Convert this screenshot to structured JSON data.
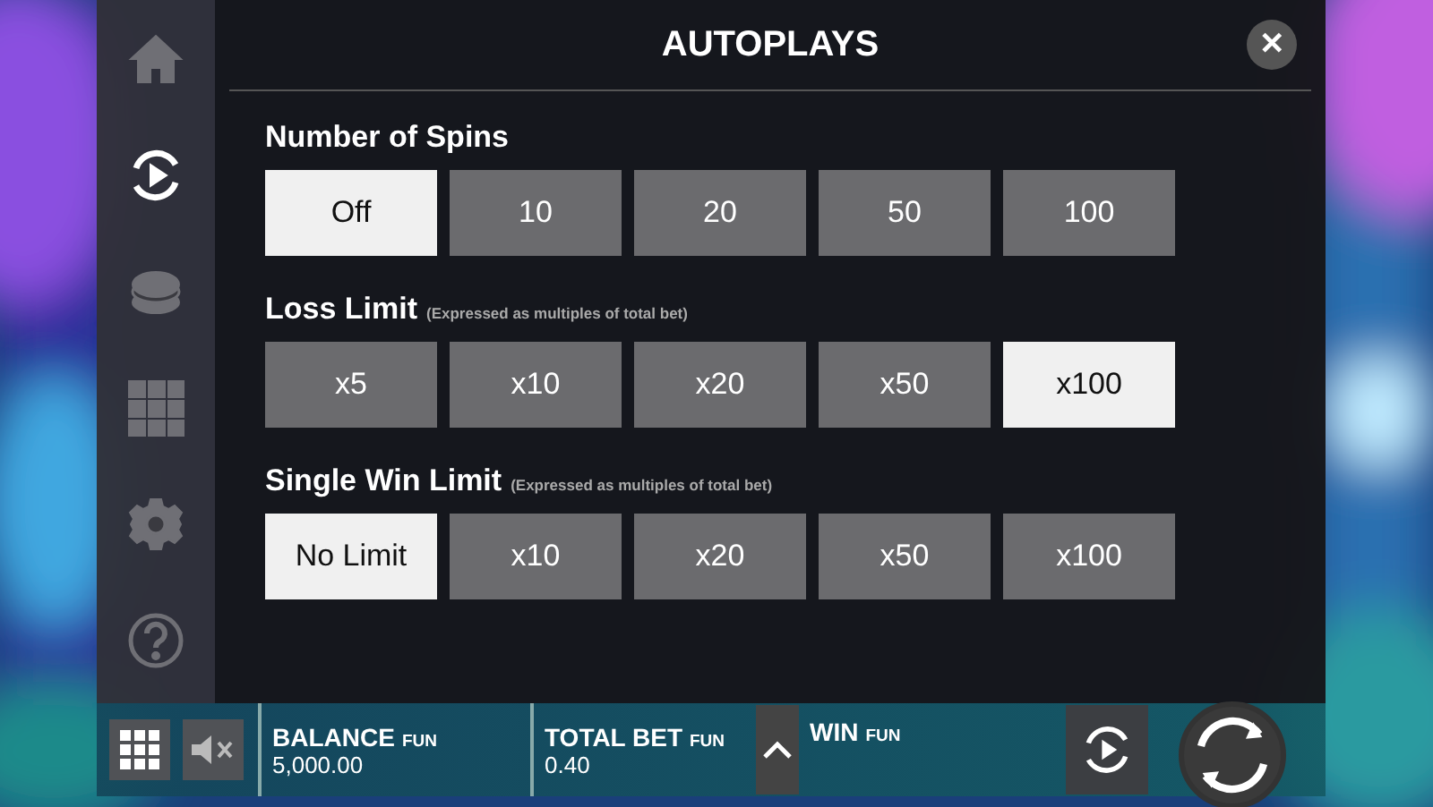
{
  "sidebar": {
    "items": [
      {
        "kind": "home",
        "selected": false
      },
      {
        "kind": "autoplay",
        "selected": true
      },
      {
        "kind": "coins",
        "selected": false
      },
      {
        "kind": "grid",
        "selected": false
      },
      {
        "kind": "settings",
        "selected": false
      },
      {
        "kind": "help",
        "selected": false
      }
    ]
  },
  "dialog": {
    "title": "AUTOPLAYS",
    "close": "✕",
    "sections": [
      {
        "heading": "Number of Spins",
        "options": [
          {
            "label": "Off",
            "selected": true
          },
          {
            "label": "10",
            "selected": false
          },
          {
            "label": "20",
            "selected": false
          },
          {
            "label": "50",
            "selected": false
          },
          {
            "label": "100",
            "selected": false
          }
        ]
      },
      {
        "heading": "Loss Limit",
        "note": "(Expressed as multiples of total bet)",
        "options": [
          {
            "label": "x5",
            "selected": false
          },
          {
            "label": "x10",
            "selected": false
          },
          {
            "label": "x20",
            "selected": false
          },
          {
            "label": "x50",
            "selected": false
          },
          {
            "label": "x100",
            "selected": true
          }
        ]
      },
      {
        "heading": "Single Win Limit",
        "note": "(Expressed as multiples of total bet)",
        "options": [
          {
            "label": "No Limit",
            "selected": true
          },
          {
            "label": "x10",
            "selected": false
          },
          {
            "label": "x20",
            "selected": false
          },
          {
            "label": "x50",
            "selected": false
          },
          {
            "label": "x100",
            "selected": false
          }
        ]
      }
    ]
  },
  "bottom_bar": {
    "muted": true,
    "fields": [
      {
        "label": "BALANCE",
        "currency": "FUN",
        "value": "5,000.00"
      },
      {
        "label": "TOTAL BET",
        "currency": "FUN",
        "value": "0.40"
      },
      {
        "label": "WIN",
        "currency": "FUN"
      }
    ]
  }
}
